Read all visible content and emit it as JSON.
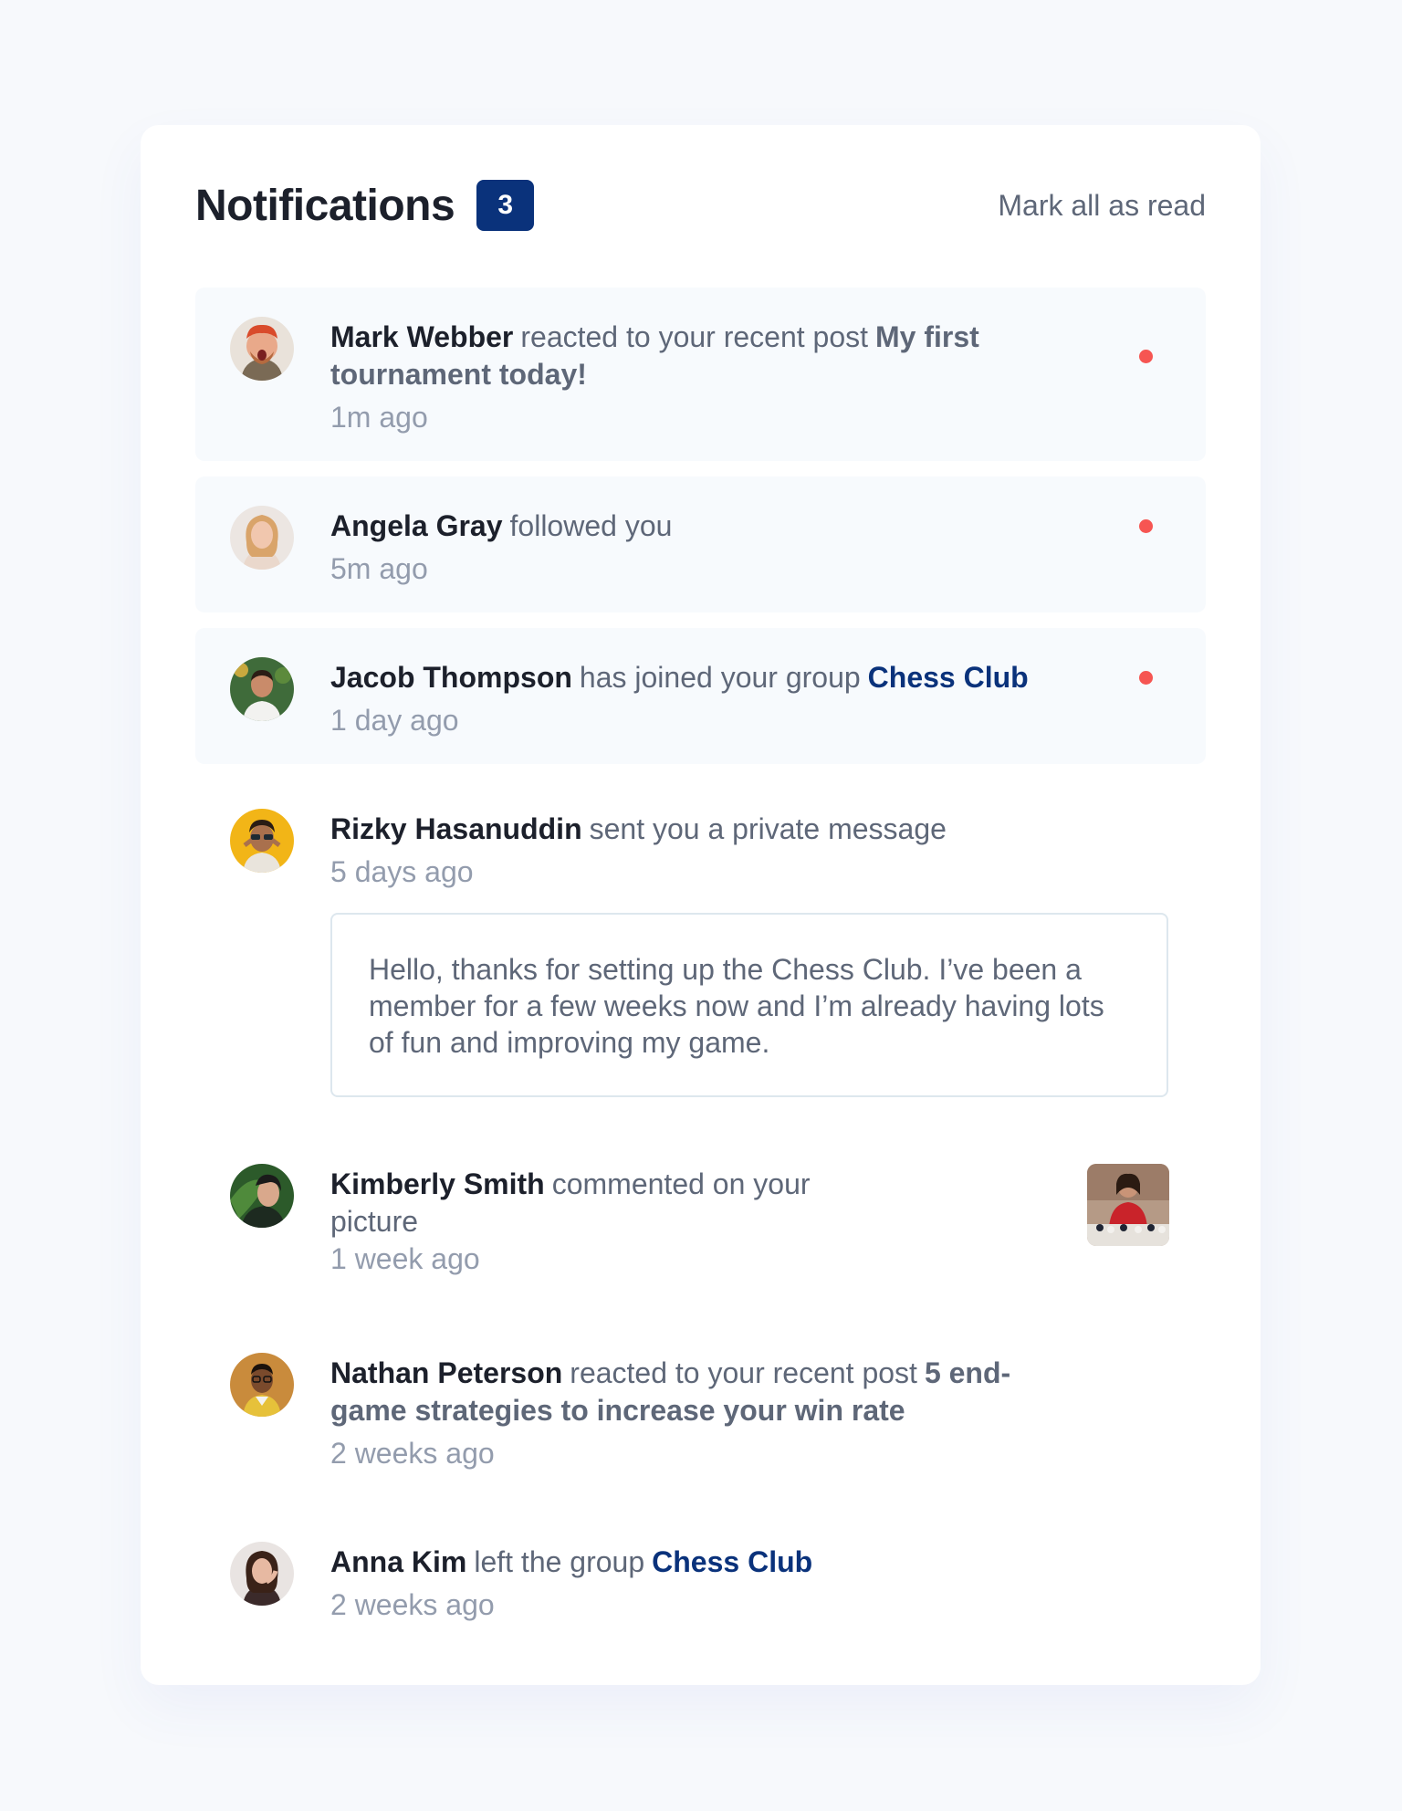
{
  "header": {
    "title": "Notifications",
    "unread_count": "3",
    "mark_all_label": "Mark all as read"
  },
  "colors": {
    "unread_bg": "#f7fafd",
    "dot": "#f65552",
    "badge": "#0a327b",
    "group_link": "#0a327b"
  },
  "notifications": [
    {
      "actor": "Mark Webber",
      "action": "reacted to your recent post",
      "post": "My first tournament today!",
      "time": "1m ago",
      "unread": true,
      "avatar": "avatar-mark-webber"
    },
    {
      "actor": "Angela Gray",
      "action": "followed you",
      "time": "5m ago",
      "unread": true,
      "avatar": "avatar-angela-gray"
    },
    {
      "actor": "Jacob Thompson",
      "action": "has joined your group",
      "group": "Chess Club",
      "time": "1 day ago",
      "unread": true,
      "avatar": "avatar-jacob-thompson"
    },
    {
      "actor": "Rizky Hasanuddin",
      "action": "sent you a private message",
      "time": "5 days ago",
      "unread": false,
      "message": "Hello, thanks for setting up the Chess Club. I’ve been a member for a few weeks now and I’m already having lots of fun and improving my game.",
      "avatar": "avatar-rizky-hasanuddin"
    },
    {
      "actor": "Kimberly Smith",
      "action": "commented on your picture",
      "time": "1 week ago",
      "unread": false,
      "picture": "chess-picture-thumbnail",
      "avatar": "avatar-kimberly-smith"
    },
    {
      "actor": "Nathan Peterson",
      "action": "reacted to your recent post",
      "post": "5 end-game strategies to increase your win rate",
      "time": "2 weeks ago",
      "unread": false,
      "avatar": "avatar-nathan-peterson"
    },
    {
      "actor": "Anna Kim",
      "action": "left the group",
      "group": "Chess Club",
      "time": "2 weeks ago",
      "unread": false,
      "avatar": "avatar-anna-kim"
    }
  ]
}
